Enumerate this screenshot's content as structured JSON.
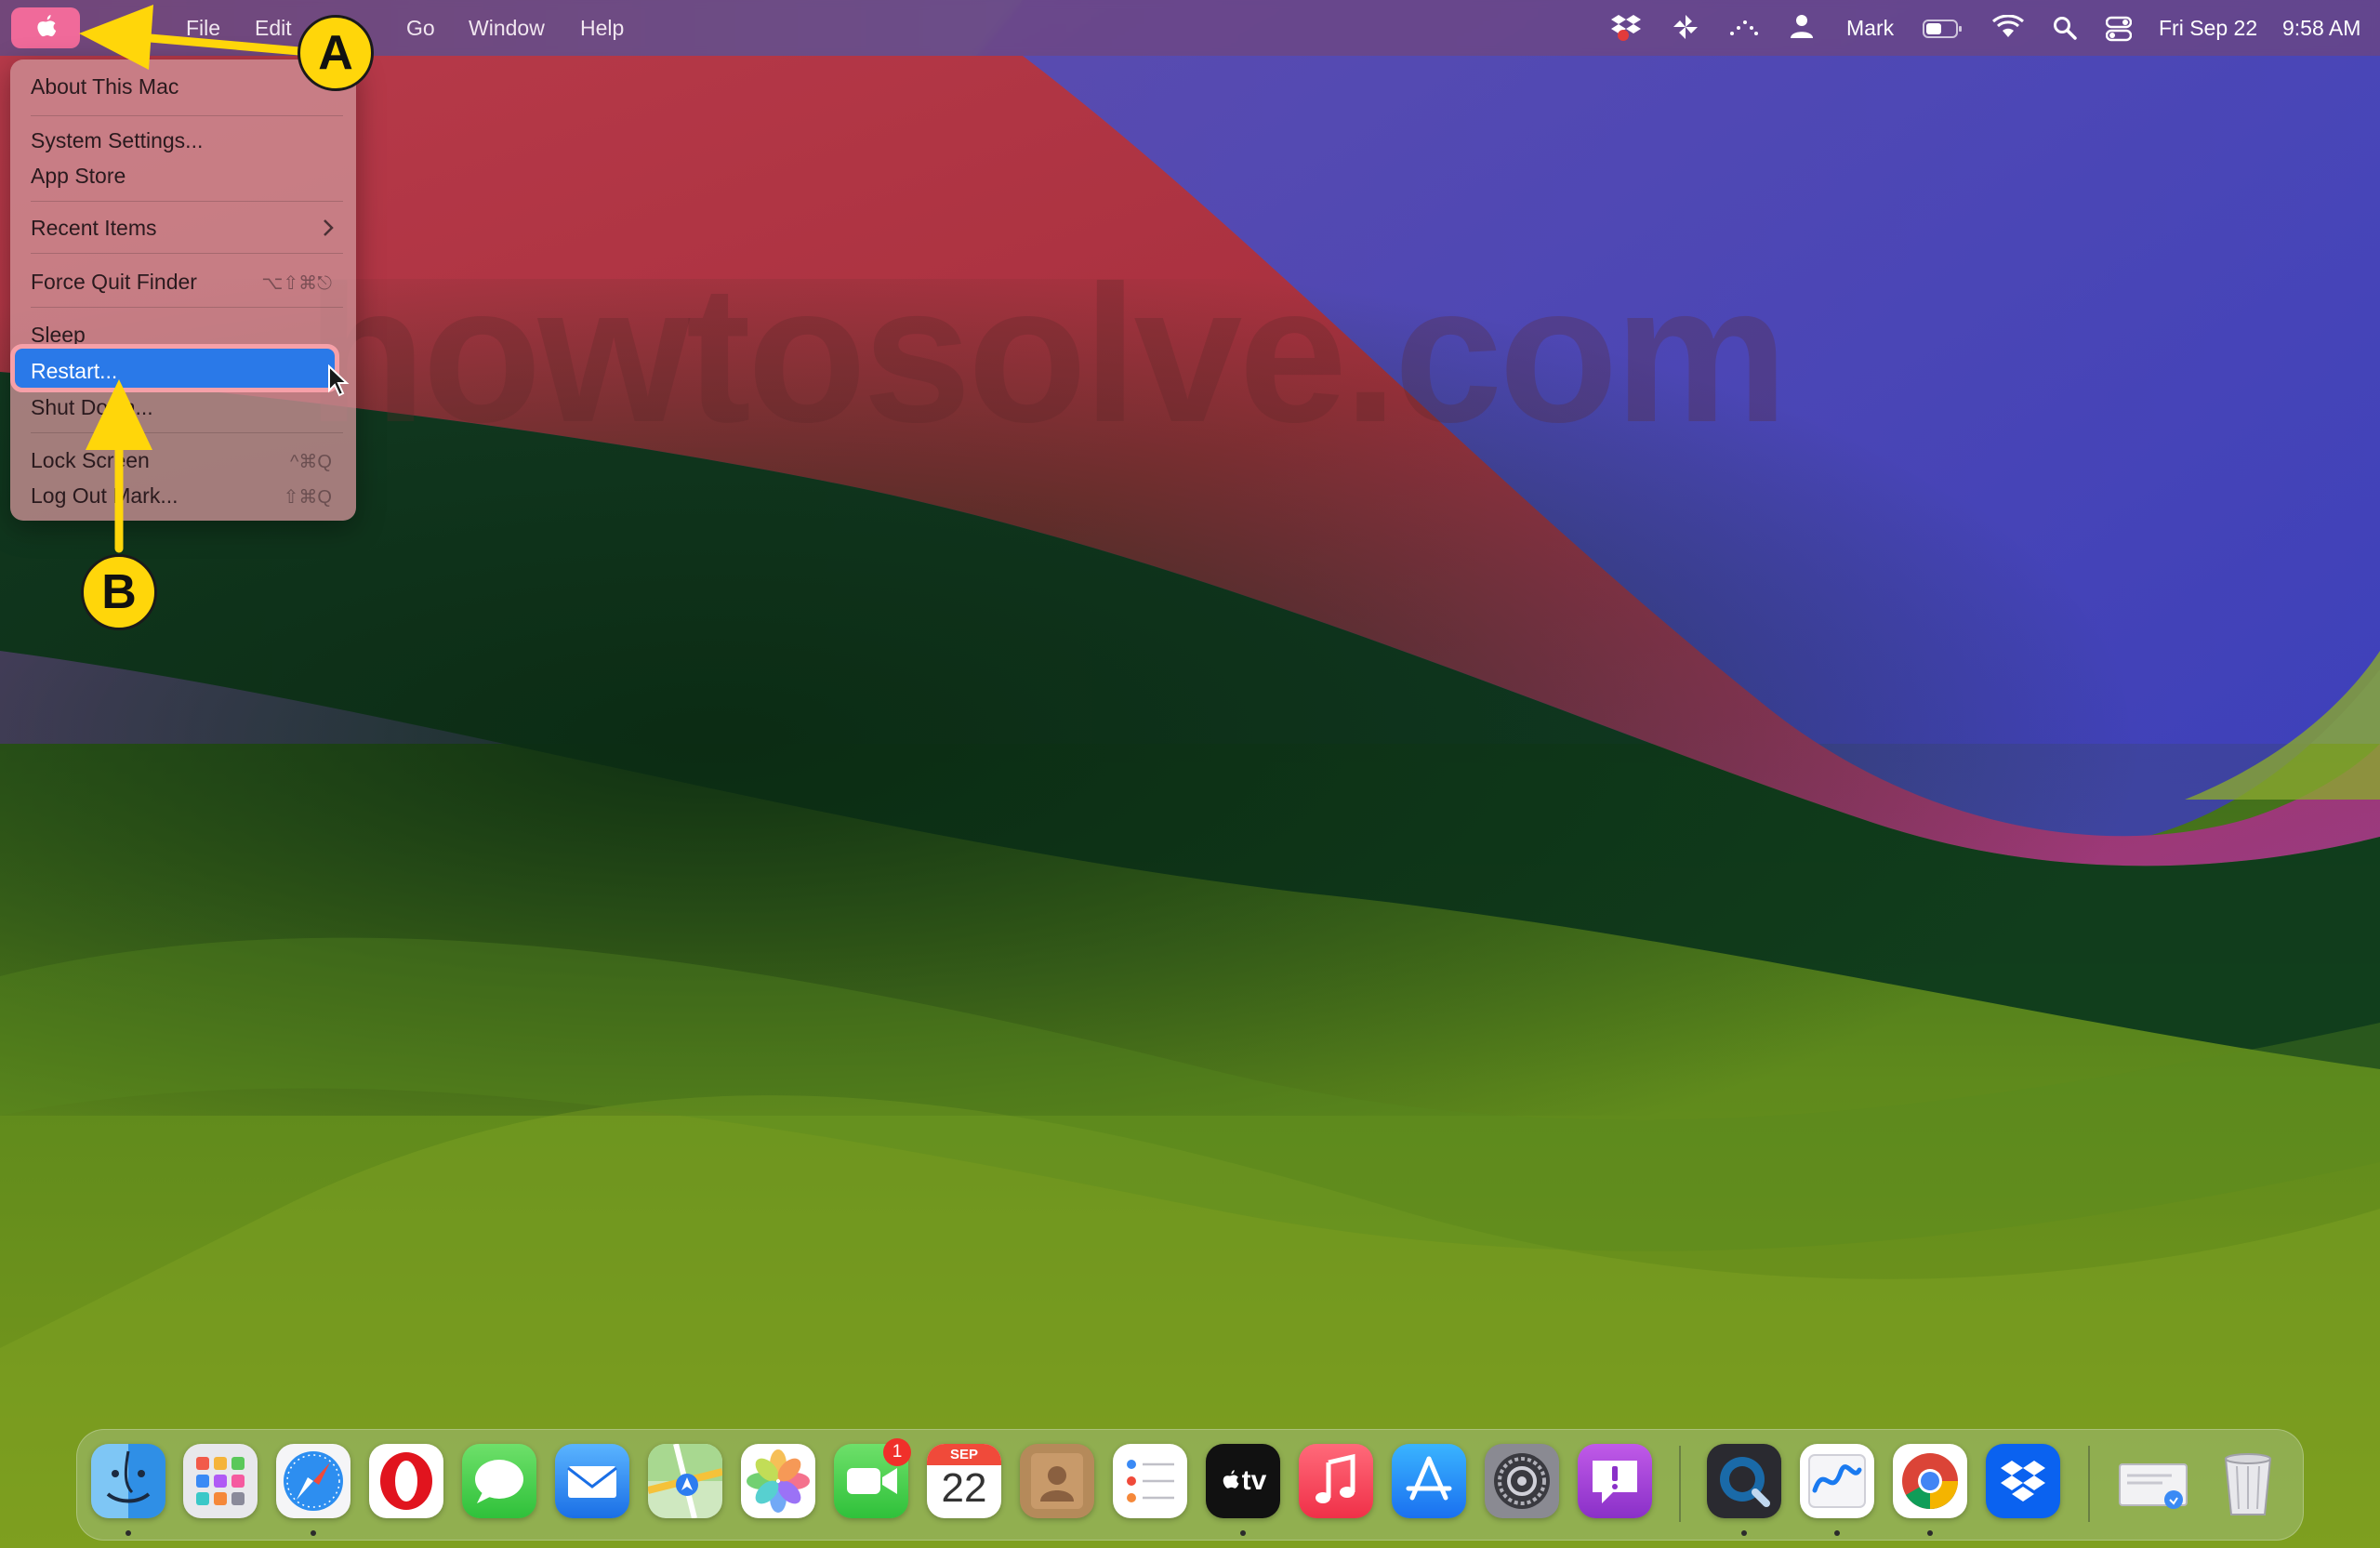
{
  "menubar": {
    "menus": [
      "File",
      "Edit",
      "Go",
      "Window",
      "Help"
    ],
    "user_name": "Mark",
    "date": "Fri Sep 22",
    "time": "9:58 AM"
  },
  "apple_menu": {
    "items": [
      {
        "label": "About This Mac",
        "shortcut": ""
      },
      {
        "label": "System Settings...",
        "shortcut": ""
      },
      {
        "label": "App Store",
        "shortcut": ""
      },
      {
        "label": "Recent Items",
        "shortcut": ""
      },
      {
        "label": "Force Quit Finder",
        "shortcut": "⌥⇧⌘⎋"
      },
      {
        "label": "Sleep",
        "shortcut": ""
      },
      {
        "label": "Restart...",
        "shortcut": ""
      },
      {
        "label": "Shut Down...",
        "shortcut": ""
      },
      {
        "label": "Lock Screen",
        "shortcut": "^⌘Q"
      },
      {
        "label": "Log Out Mark...",
        "shortcut": "⇧⌘Q"
      }
    ],
    "highlighted": "Restart..."
  },
  "annotations": {
    "a": "A",
    "b": "B"
  },
  "watermark": "howtosolve.com",
  "dock": {
    "facetime_badge": "1",
    "calendar_month": "SEP",
    "calendar_day": "22",
    "tv_label": "tv",
    "apps": [
      "Finder",
      "Launchpad",
      "Safari",
      "Opera",
      "Messages",
      "Mail",
      "Maps",
      "Photos",
      "FaceTime",
      "Calendar",
      "Contacts",
      "Reminders",
      "Apple TV",
      "Music",
      "App Store",
      "System Settings",
      "Feedback Assistant",
      "QuickTime Player",
      "Freeform",
      "Google Chrome",
      "Dropbox",
      "Downloads",
      "Trash"
    ]
  },
  "colors": {
    "highlight": "#2a79e8",
    "annotation": "#ffd60a",
    "apple_button": "#f06a9a"
  }
}
